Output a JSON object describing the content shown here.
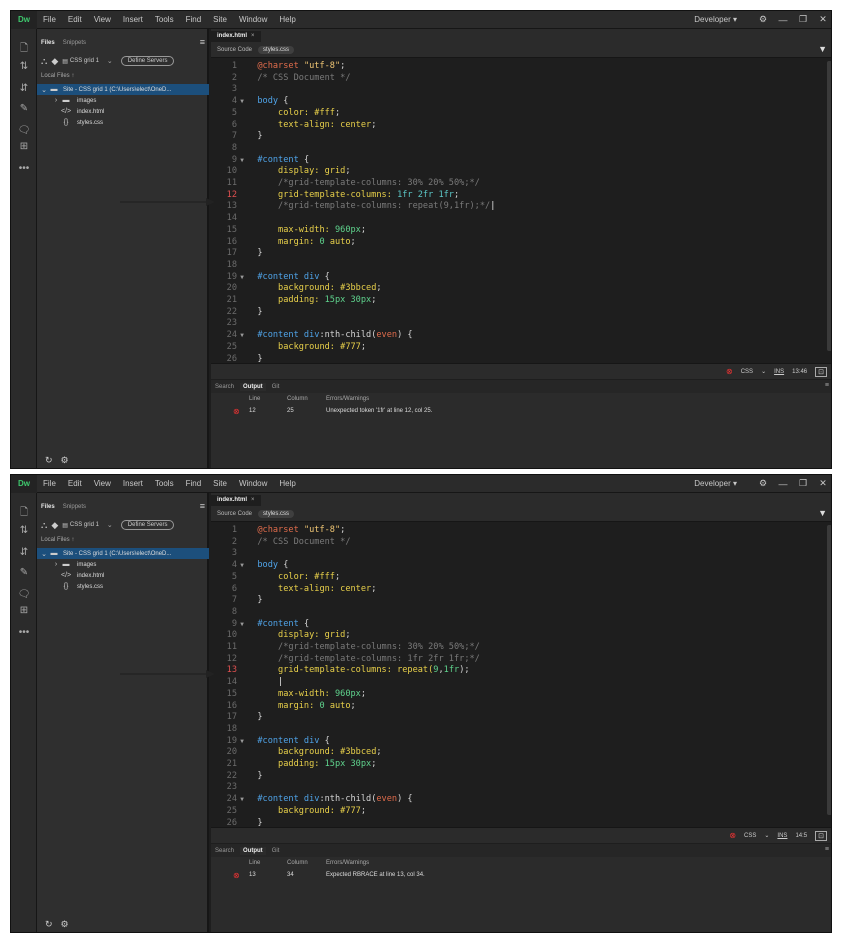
{
  "app": {
    "logo": "Dw"
  },
  "menu": [
    "File",
    "Edit",
    "View",
    "Insert",
    "Tools",
    "Find",
    "Site",
    "Window",
    "Help"
  ],
  "workspace": "Developer",
  "files_panel": {
    "tabs": [
      "Files",
      "Snippets"
    ],
    "site_name": "CSS grid 1",
    "define_servers": "Define Servers",
    "local_files": "Local Files",
    "site_root": "Site - CSS grid 1 (C:\\Users\\elect\\OneD...",
    "items": [
      "images",
      "index.html",
      "styles.css"
    ]
  },
  "doc_tab": "index.html",
  "related": {
    "source": "Source Code",
    "css": "styles.css"
  },
  "panels": [
    {
      "lines": [
        [
          {
            "t": "@charset ",
            "c": "#e06c4c"
          },
          {
            "t": "\"utf-8\"",
            "c": "#f0c674"
          },
          {
            "t": ";",
            "c": "#d6d6d6"
          }
        ],
        [
          {
            "t": "/* CSS Document */",
            "c": "#7a7a7a"
          }
        ],
        [],
        [
          {
            "t": "body ",
            "c": "#4fa3e8"
          },
          {
            "t": "{",
            "c": "#d6d6d6"
          }
        ],
        [
          {
            "t": "    color: ",
            "c": "#e8d04a"
          },
          {
            "t": "#fff",
            "c": "#e8d04a"
          },
          {
            "t": ";",
            "c": "#d6d6d6"
          }
        ],
        [
          {
            "t": "    text-align: ",
            "c": "#e8d04a"
          },
          {
            "t": "center",
            "c": "#e8d04a"
          },
          {
            "t": ";",
            "c": "#d6d6d6"
          }
        ],
        [
          {
            "t": "}",
            "c": "#d6d6d6"
          }
        ],
        [],
        [
          {
            "t": "#content ",
            "c": "#4fa3e8"
          },
          {
            "t": "{",
            "c": "#d6d6d6"
          }
        ],
        [
          {
            "t": "    display: ",
            "c": "#e8d04a"
          },
          {
            "t": "grid",
            "c": "#e8d04a"
          },
          {
            "t": ";",
            "c": "#d6d6d6"
          }
        ],
        [
          {
            "t": "    /*grid-template-columns: 30% 20% 50%;*/",
            "c": "#7a7a7a"
          }
        ],
        [
          {
            "t": "    grid-template-columns: ",
            "c": "#e8d04a"
          },
          {
            "t": "1fr 2fr 1fr",
            "c": "#5cc8c8"
          },
          {
            "t": ";",
            "c": "#d6d6d6"
          }
        ],
        [
          {
            "t": "    /*grid-template-columns: repeat(9,1fr);*/",
            "c": "#7a7a7a"
          },
          {
            "t": "|",
            "c": "#eeeeee"
          }
        ],
        [],
        [
          {
            "t": "    max-width: ",
            "c": "#e8d04a"
          },
          {
            "t": "960px",
            "c": "#5fd38d"
          },
          {
            "t": ";",
            "c": "#d6d6d6"
          }
        ],
        [
          {
            "t": "    margin: ",
            "c": "#e8d04a"
          },
          {
            "t": "0",
            "c": "#5fd38d"
          },
          {
            "t": " auto",
            "c": "#e8d04a"
          },
          {
            "t": ";",
            "c": "#d6d6d6"
          }
        ],
        [
          {
            "t": "}",
            "c": "#d6d6d6"
          }
        ],
        [],
        [
          {
            "t": "#content div ",
            "c": "#4fa3e8"
          },
          {
            "t": "{",
            "c": "#d6d6d6"
          }
        ],
        [
          {
            "t": "    background: ",
            "c": "#e8d04a"
          },
          {
            "t": "#3bbced",
            "c": "#e8d04a"
          },
          {
            "t": ";",
            "c": "#d6d6d6"
          }
        ],
        [
          {
            "t": "    padding: ",
            "c": "#e8d04a"
          },
          {
            "t": "15px 30px",
            "c": "#5fd38d"
          },
          {
            "t": ";",
            "c": "#d6d6d6"
          }
        ],
        [
          {
            "t": "}",
            "c": "#d6d6d6"
          }
        ],
        [],
        [
          {
            "t": "#content div",
            "c": "#4fa3e8"
          },
          {
            "t": ":nth-child(",
            "c": "#d6d6d6"
          },
          {
            "t": "even",
            "c": "#e06c4c"
          },
          {
            "t": ") {",
            "c": "#d6d6d6"
          }
        ],
        [
          {
            "t": "    background: ",
            "c": "#e8d04a"
          },
          {
            "t": "#777",
            "c": "#e8d04a"
          },
          {
            "t": ";",
            "c": "#d6d6d6"
          }
        ],
        [
          {
            "t": "}",
            "c": "#d6d6d6"
          }
        ]
      ],
      "error_line": 12,
      "status": {
        "mode": "CSS",
        "ins": "INS",
        "pos": "13:46"
      },
      "output": {
        "line": "12",
        "column": "25",
        "message": "Unexpected token '1fr' at line 12, col 25."
      }
    },
    {
      "lines": [
        [
          {
            "t": "@charset ",
            "c": "#e06c4c"
          },
          {
            "t": "\"utf-8\"",
            "c": "#f0c674"
          },
          {
            "t": ";",
            "c": "#d6d6d6"
          }
        ],
        [
          {
            "t": "/* CSS Document */",
            "c": "#7a7a7a"
          }
        ],
        [],
        [
          {
            "t": "body ",
            "c": "#4fa3e8"
          },
          {
            "t": "{",
            "c": "#d6d6d6"
          }
        ],
        [
          {
            "t": "    color: ",
            "c": "#e8d04a"
          },
          {
            "t": "#fff",
            "c": "#e8d04a"
          },
          {
            "t": ";",
            "c": "#d6d6d6"
          }
        ],
        [
          {
            "t": "    text-align: ",
            "c": "#e8d04a"
          },
          {
            "t": "center",
            "c": "#e8d04a"
          },
          {
            "t": ";",
            "c": "#d6d6d6"
          }
        ],
        [
          {
            "t": "}",
            "c": "#d6d6d6"
          }
        ],
        [],
        [
          {
            "t": "#content ",
            "c": "#4fa3e8"
          },
          {
            "t": "{",
            "c": "#d6d6d6"
          }
        ],
        [
          {
            "t": "    display: ",
            "c": "#e8d04a"
          },
          {
            "t": "grid",
            "c": "#e8d04a"
          },
          {
            "t": ";",
            "c": "#d6d6d6"
          }
        ],
        [
          {
            "t": "    /*grid-template-columns: 30% 20% 50%;*/",
            "c": "#7a7a7a"
          }
        ],
        [
          {
            "t": "    /*grid-template-columns: 1fr 2fr 1fr;*/",
            "c": "#7a7a7a"
          }
        ],
        [
          {
            "t": "    grid-template-columns: ",
            "c": "#e8d04a"
          },
          {
            "t": "repeat(",
            "c": "#e8d04a"
          },
          {
            "t": "9",
            "c": "#5fd38d"
          },
          {
            "t": ",",
            "c": "#d6d6d6"
          },
          {
            "t": "1fr",
            "c": "#5fd38d"
          },
          {
            "t": ");",
            "c": "#d6d6d6"
          }
        ],
        [
          {
            "t": "    |",
            "c": "#eeeeee"
          }
        ],
        [
          {
            "t": "    max-width: ",
            "c": "#e8d04a"
          },
          {
            "t": "960px",
            "c": "#5fd38d"
          },
          {
            "t": ";",
            "c": "#d6d6d6"
          }
        ],
        [
          {
            "t": "    margin: ",
            "c": "#e8d04a"
          },
          {
            "t": "0",
            "c": "#5fd38d"
          },
          {
            "t": " auto",
            "c": "#e8d04a"
          },
          {
            "t": ";",
            "c": "#d6d6d6"
          }
        ],
        [
          {
            "t": "}",
            "c": "#d6d6d6"
          }
        ],
        [],
        [
          {
            "t": "#content div ",
            "c": "#4fa3e8"
          },
          {
            "t": "{",
            "c": "#d6d6d6"
          }
        ],
        [
          {
            "t": "    background: ",
            "c": "#e8d04a"
          },
          {
            "t": "#3bbced",
            "c": "#e8d04a"
          },
          {
            "t": ";",
            "c": "#d6d6d6"
          }
        ],
        [
          {
            "t": "    padding: ",
            "c": "#e8d04a"
          },
          {
            "t": "15px 30px",
            "c": "#5fd38d"
          },
          {
            "t": ";",
            "c": "#d6d6d6"
          }
        ],
        [
          {
            "t": "}",
            "c": "#d6d6d6"
          }
        ],
        [],
        [
          {
            "t": "#content div",
            "c": "#4fa3e8"
          },
          {
            "t": ":nth-child(",
            "c": "#d6d6d6"
          },
          {
            "t": "even",
            "c": "#e06c4c"
          },
          {
            "t": ") {",
            "c": "#d6d6d6"
          }
        ],
        [
          {
            "t": "    background: ",
            "c": "#e8d04a"
          },
          {
            "t": "#777",
            "c": "#e8d04a"
          },
          {
            "t": ";",
            "c": "#d6d6d6"
          }
        ],
        [
          {
            "t": "}",
            "c": "#d6d6d6"
          }
        ]
      ],
      "error_line": 13,
      "status": {
        "mode": "CSS",
        "ins": "INS",
        "pos": "14:5"
      },
      "output": {
        "line": "13",
        "column": "34",
        "message": "Expected RBRACE at line 13, col 34."
      }
    }
  ],
  "output_panel": {
    "tabs": [
      "Search",
      "Output",
      "Git"
    ],
    "col_line": "Line",
    "col_column": "Column",
    "col_msg": "Errors/Warnings"
  }
}
